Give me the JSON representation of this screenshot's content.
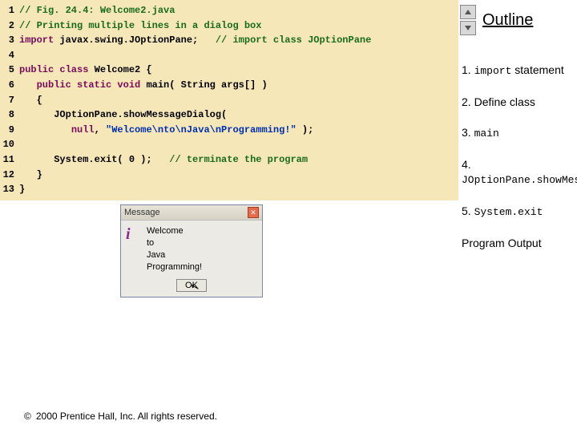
{
  "code": {
    "lines": [
      {
        "n": "1",
        "pre": "",
        "tokens": [
          {
            "c": "cm",
            "t": "// Fig. 24.4: Welcome2.java"
          }
        ]
      },
      {
        "n": "2",
        "pre": "",
        "tokens": [
          {
            "c": "cm",
            "t": "// Printing multiple lines in a dialog box"
          }
        ]
      },
      {
        "n": "3",
        "pre": "",
        "tokens": [
          {
            "c": "kw",
            "t": "import"
          },
          {
            "c": "",
            "t": " javax.swing.JOptionPane;   "
          },
          {
            "c": "cm",
            "t": "// import class JOptionPane"
          }
        ]
      },
      {
        "n": "4",
        "pre": "",
        "tokens": []
      },
      {
        "n": "5",
        "pre": "",
        "tokens": [
          {
            "c": "kw",
            "t": "public class "
          },
          {
            "c": "",
            "t": "Welcome2 {"
          }
        ]
      },
      {
        "n": "6",
        "pre": "   ",
        "tokens": [
          {
            "c": "kw",
            "t": "public static void "
          },
          {
            "c": "",
            "t": "main( String args[] )"
          }
        ]
      },
      {
        "n": "7",
        "pre": "   ",
        "tokens": [
          {
            "c": "",
            "t": "{"
          }
        ]
      },
      {
        "n": "8",
        "pre": "      ",
        "tokens": [
          {
            "c": "",
            "t": "JOptionPane.showMessageDialog("
          }
        ]
      },
      {
        "n": "9",
        "pre": "         ",
        "tokens": [
          {
            "c": "kw",
            "t": "null"
          },
          {
            "c": "",
            "t": ", "
          },
          {
            "c": "str",
            "t": "\"Welcome\\nto\\nJava\\nProgramming!\""
          },
          {
            "c": "",
            "t": " );"
          }
        ]
      },
      {
        "n": "10",
        "pre": "",
        "tokens": []
      },
      {
        "n": "11",
        "pre": "      ",
        "tokens": [
          {
            "c": "",
            "t": "System.exit( 0 );   "
          },
          {
            "c": "cm",
            "t": "// terminate the program"
          }
        ]
      },
      {
        "n": "12",
        "pre": "   ",
        "tokens": [
          {
            "c": "",
            "t": "}"
          }
        ]
      },
      {
        "n": "13",
        "pre": "",
        "tokens": [
          {
            "c": "",
            "t": "}"
          }
        ]
      }
    ]
  },
  "sidebar": {
    "title": "Outline",
    "items": [
      {
        "num": "1. ",
        "mono": "import",
        "after": " statement"
      },
      {
        "num": "2. ",
        "mono": "",
        "after": "Define class"
      },
      {
        "num": "3. ",
        "mono": "main",
        "after": ""
      },
      {
        "num": "4.",
        "mono": "JOptionPane.showMessageDialog",
        "after": "",
        "break": true
      },
      {
        "num": "5. ",
        "mono": "System.exit",
        "after": ""
      },
      {
        "num": "",
        "mono": "",
        "after": "Program Output"
      }
    ]
  },
  "dialog": {
    "title": "Message",
    "lines": [
      "Welcome",
      "to",
      "Java",
      "Programming!"
    ],
    "ok": "OK"
  },
  "footer": {
    "symbol": "©",
    "text": "2000 Prentice Hall, Inc.  All rights reserved."
  }
}
